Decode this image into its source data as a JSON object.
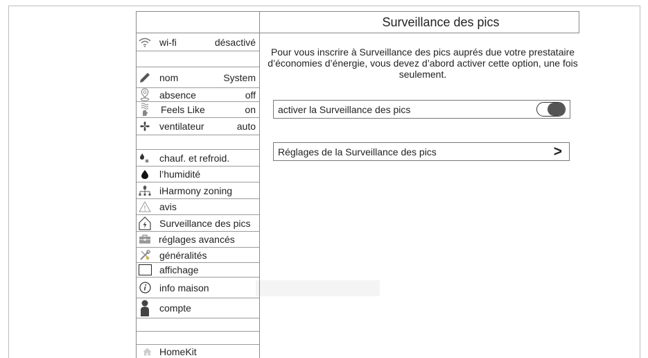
{
  "header": {
    "title": "Surveillance des pics"
  },
  "sidebar": {
    "items": [
      {
        "icon": "wifi-icon",
        "label": "wi-fi",
        "value": "désactivé"
      },
      {
        "icon": "pencil-icon",
        "label": "nom",
        "value": "System"
      },
      {
        "icon": "person-pin-icon",
        "label": "absence",
        "value": "off"
      },
      {
        "icon": "feels-like-icon",
        "label": "Feels Like",
        "value": "on"
      },
      {
        "icon": "fan-icon",
        "label": "ventilateur",
        "value": "auto"
      },
      {
        "icon": "heat-cool-icon",
        "label": "chauf. et refroid."
      },
      {
        "icon": "droplet-icon",
        "label": "l’humidité"
      },
      {
        "icon": "zoning-icon",
        "label": "iHarmony zoning"
      },
      {
        "icon": "warning-icon",
        "label": "avis"
      },
      {
        "icon": "peak-house-icon",
        "label": "Surveillance des pics"
      },
      {
        "icon": "toolbox-icon",
        "label": "réglages avancés"
      },
      {
        "icon": "tools-icon",
        "label": "généralités"
      },
      {
        "icon": "display-icon",
        "label": "affichage"
      },
      {
        "icon": "info-icon",
        "label": "info maison"
      },
      {
        "icon": "person-icon",
        "label": "compte"
      },
      {
        "icon": "home-icon",
        "label": "HomeKit"
      }
    ]
  },
  "main": {
    "description": "Pour vous inscrire à Surveillance des pics auprés due votre prestataire\nd’économies d’énergie, vous devez d’abord activer cette option, une fois\nseulement.",
    "toggle_row": {
      "label": "activer la Surveillance des pics"
    },
    "settings_row": {
      "label": "Réglages de la Surveillance des pics",
      "chevron": ">"
    }
  },
  "colors": {
    "border": "#8a8a8a",
    "text": "#222222",
    "icon": "#888888",
    "knob": "#555555"
  }
}
